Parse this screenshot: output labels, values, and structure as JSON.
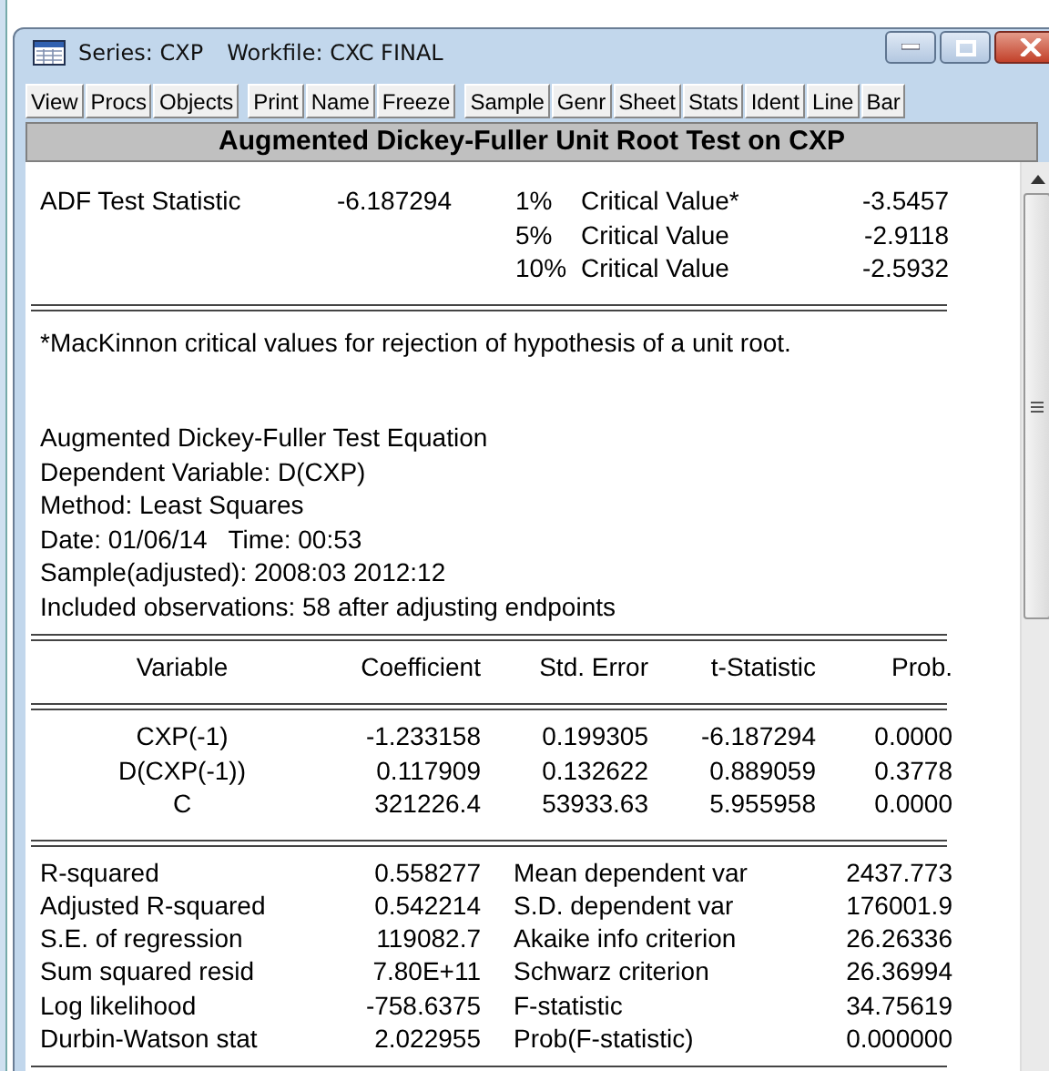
{
  "window": {
    "series": "Series: CXP",
    "workfile": "Workfile: CXC FINAL"
  },
  "toolbar": [
    [
      "View",
      "Procs",
      "Objects"
    ],
    [
      "Print",
      "Name",
      "Freeze"
    ],
    [
      "Sample",
      "Genr",
      "Sheet",
      "Stats",
      "Ident",
      "Line",
      "Bar"
    ]
  ],
  "heading": "Augmented Dickey-Fuller Unit Root Test on CXP",
  "adf": {
    "label": "ADF Test Statistic",
    "value": "-6.187294",
    "critical": [
      {
        "level": "1%",
        "label": "Critical Value*",
        "value": "-3.5457"
      },
      {
        "level": "5%",
        "label": "Critical Value",
        "value": "-2.9118"
      },
      {
        "level": "10%",
        "label": "Critical Value",
        "value": "-2.5932"
      }
    ]
  },
  "footnote": "*MacKinnon critical values for rejection of hypothesis of a unit root.",
  "equation_info": [
    "Augmented Dickey-Fuller Test Equation",
    "Dependent Variable: D(CXP)",
    "Method: Least Squares",
    "Date: 01/06/14   Time: 00:53",
    "Sample(adjusted): 2008:03 2012:12",
    "Included observations: 58 after adjusting endpoints"
  ],
  "coefficients": {
    "columns": [
      "Variable",
      "Coefficient",
      "Std. Error",
      "t-Statistic",
      "Prob."
    ],
    "rows": [
      [
        "CXP(-1)",
        "-1.233158",
        "0.199305",
        "-6.187294",
        "0.0000"
      ],
      [
        "D(CXP(-1))",
        "0.117909",
        "0.132622",
        "0.889059",
        "0.3778"
      ],
      [
        "C",
        "321226.4",
        "53933.63",
        "5.955958",
        "0.0000"
      ]
    ]
  },
  "statistics": [
    [
      "R-squared",
      "0.558277",
      "Mean dependent var",
      "2437.773"
    ],
    [
      "Adjusted R-squared",
      "0.542214",
      "S.D. dependent var",
      "176001.9"
    ],
    [
      "S.E. of regression",
      "119082.7",
      "Akaike info criterion",
      "26.26336"
    ],
    [
      "Sum squared resid",
      "7.80E+11",
      "Schwarz criterion",
      "26.36994"
    ],
    [
      "Log likelihood",
      "-758.6375",
      "F-statistic",
      "34.75619"
    ],
    [
      "Durbin-Watson stat",
      "2.022955",
      "Prob(F-statistic)",
      "0.000000"
    ]
  ]
}
